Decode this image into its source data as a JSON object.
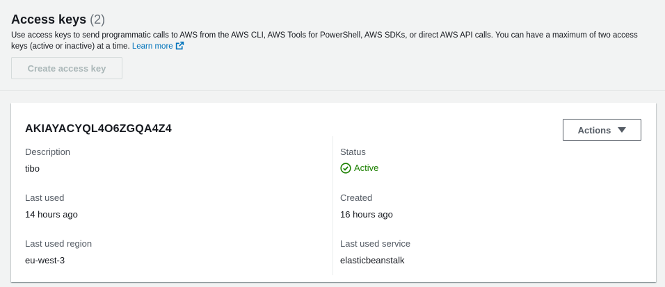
{
  "header": {
    "title": "Access keys",
    "count": "(2)",
    "description": "Use access keys to send programmatic calls to AWS from the AWS CLI, AWS Tools for PowerShell, AWS SDKs, or direct AWS API calls. You can have a maximum of two access keys (active or inactive) at a time.",
    "learn_more": "Learn more",
    "create_button": "Create access key"
  },
  "key": {
    "id": "AKIAYACYQL4O6ZGQA4Z4",
    "actions_label": "Actions",
    "description_label": "Description",
    "description_value": "tibo",
    "last_used_label": "Last used",
    "last_used_value": "14 hours ago",
    "last_used_region_label": "Last used region",
    "last_used_region_value": "eu-west-3",
    "status_label": "Status",
    "status_value": "Active",
    "created_label": "Created",
    "created_value": "16 hours ago",
    "last_used_service_label": "Last used service",
    "last_used_service_value": "elasticbeanstalk"
  },
  "colors": {
    "link": "#0073bb",
    "active": "#1d8102",
    "disabled_text": "#aab7b8"
  },
  "icons": {
    "external_link": "external-link-icon",
    "status": "check-circle-icon",
    "dropdown": "caret-down-icon"
  }
}
